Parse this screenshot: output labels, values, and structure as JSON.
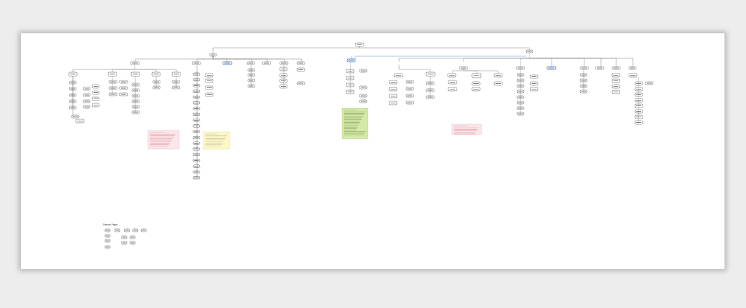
{
  "canvas": {
    "background": "#ededed",
    "paper_color": "#ffffff",
    "node_stroke": "#555555",
    "accent_blue": "#2a6fd1",
    "note_colors": {
      "pink": "#fbe6ea",
      "yellow": "#fdf9c4",
      "green": "#d4e8a7"
    }
  },
  "legend": {
    "title": "Sitemap Pages"
  },
  "notes": [
    {
      "id": "note-pink-left",
      "color": "pink"
    },
    {
      "id": "note-yellow",
      "color": "yellow"
    },
    {
      "id": "note-green",
      "color": "green"
    },
    {
      "id": "note-pink-right",
      "color": "pink"
    }
  ]
}
